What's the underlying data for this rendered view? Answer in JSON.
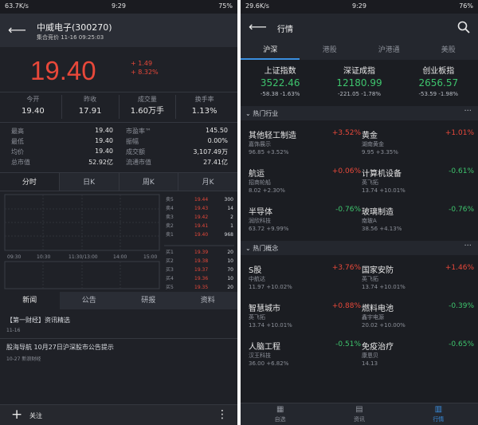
{
  "left": {
    "status": {
      "speed": "63.7K/s",
      "time": "9:29",
      "battery": "75%"
    },
    "header": {
      "title": "中威电子(300270)",
      "subtitle": "集合竞价 11-16 09:25:03"
    },
    "price": {
      "value": "19.40",
      "change": "+ 1.49",
      "percent": "+ 8.32%"
    },
    "quote_top": [
      {
        "label": "今开",
        "value": "19.40"
      },
      {
        "label": "昨收",
        "value": "17.91"
      },
      {
        "label": "成交量",
        "value": "1.60万手"
      },
      {
        "label": "换手率",
        "value": "1.13%"
      }
    ],
    "quote_rows": [
      {
        "l1": "最高",
        "v1": "19.40",
        "l2": "市盈率™",
        "v2": "145.50"
      },
      {
        "l1": "最低",
        "v1": "19.40",
        "l2": "振幅",
        "v2": "0.00%"
      },
      {
        "l1": "均价",
        "v1": "19.40",
        "l2": "成交额",
        "v2": "3,107.49万"
      },
      {
        "l1": "总市值",
        "v1": "52.92亿",
        "l2": "流通市值",
        "v2": "27.41亿"
      }
    ],
    "chart_tabs": [
      "分时",
      "日K",
      "周K",
      "月K"
    ],
    "time_axis": [
      "09:30",
      "10:30",
      "11:30/13:00",
      "14:00",
      "15:00"
    ],
    "orderbook_sell": [
      {
        "label": "卖5",
        "price": "19.44",
        "vol": "300"
      },
      {
        "label": "卖4",
        "price": "19.43",
        "vol": "14"
      },
      {
        "label": "卖3",
        "price": "19.42",
        "vol": "2"
      },
      {
        "label": "卖2",
        "price": "19.41",
        "vol": "1"
      },
      {
        "label": "卖1",
        "price": "19.40",
        "vol": "968"
      }
    ],
    "orderbook_buy": [
      {
        "label": "买1",
        "price": "19.39",
        "vol": "20"
      },
      {
        "label": "买2",
        "price": "19.38",
        "vol": "10"
      },
      {
        "label": "买3",
        "price": "19.37",
        "vol": "70"
      },
      {
        "label": "买4",
        "price": "19.36",
        "vol": "10"
      },
      {
        "label": "买5",
        "price": "19.35",
        "vol": "20"
      }
    ],
    "news_tabs": [
      "新闻",
      "公告",
      "研报",
      "资料"
    ],
    "news": [
      {
        "title": "【第一财经】资讯精选",
        "meta": "11-16"
      },
      {
        "title": "股海导航 10月27日沪深股市公告提示",
        "meta": "10-27 新浪财经"
      }
    ],
    "bottom": {
      "follow": "关注"
    }
  },
  "right": {
    "status": {
      "speed": "29.6K/s",
      "time": "9:29",
      "battery": "76%"
    },
    "title": "行情",
    "tabs": [
      "沪深",
      "港股",
      "沪港通",
      "美股"
    ],
    "indices": [
      {
        "name": "上证指数",
        "price": "3522.46",
        "change": "-58.38 -1.63%"
      },
      {
        "name": "深证成指",
        "price": "12180.99",
        "change": "-221.05 -1.78%"
      },
      {
        "name": "创业板指",
        "price": "2656.57",
        "change": "-53.59 -1.98%"
      }
    ],
    "hot_industry_title": "热门行业",
    "hot_industry": [
      {
        "name": "其他轻工制造",
        "pct": "+3.52%",
        "leader": "嘉饰展示",
        "stat": "96.85 +3.52%",
        "dir": "up"
      },
      {
        "name": "黄金",
        "pct": "+1.01%",
        "leader": "湖南黄金",
        "stat": "9.95 +3.35%",
        "dir": "up"
      },
      {
        "name": "航运",
        "pct": "+0.06%",
        "leader": "招商轮船",
        "stat": "8.02 +2.30%",
        "dir": "up"
      },
      {
        "name": "计算机设备",
        "pct": "-0.61%",
        "leader": "英飞拓",
        "stat": "13.74 +10.01%",
        "dir": "down"
      },
      {
        "name": "半导体",
        "pct": "-0.76%",
        "leader": "润欣科技",
        "stat": "63.72 +9.99%",
        "dir": "down"
      },
      {
        "name": "玻璃制造",
        "pct": "-0.76%",
        "leader": "南玻A",
        "stat": "38.56 +4.13%",
        "dir": "down"
      }
    ],
    "hot_concept_title": "热门概念",
    "hot_concept": [
      {
        "name": "S股",
        "pct": "+3.76%",
        "leader": "中航达",
        "stat": "11.97 +10.02%",
        "dir": "up"
      },
      {
        "name": "国家安防",
        "pct": "+1.46%",
        "leader": "英飞拓",
        "stat": "13.74 +10.01%",
        "dir": "up"
      },
      {
        "name": "智慧城市",
        "pct": "+0.88%",
        "leader": "英飞拓",
        "stat": "13.74 +10.01%",
        "dir": "up"
      },
      {
        "name": "燃料电池",
        "pct": "-0.39%",
        "leader": "鑫宇电源",
        "stat": "20.02 +10.00%",
        "dir": "down"
      },
      {
        "name": "人脑工程",
        "pct": "-0.51%",
        "leader": "汉王科技",
        "stat": "36.00 +6.82%",
        "dir": "down"
      },
      {
        "name": "免疫治疗",
        "pct": "-0.65%",
        "leader": "康恩贝",
        "stat": "14.13",
        "dir": "down"
      }
    ],
    "bottom_nav": [
      "自选",
      "资讯",
      "行情"
    ]
  },
  "colors": {
    "up": "#e8483a",
    "down": "#3ec46d",
    "bg": "#1f2127"
  }
}
